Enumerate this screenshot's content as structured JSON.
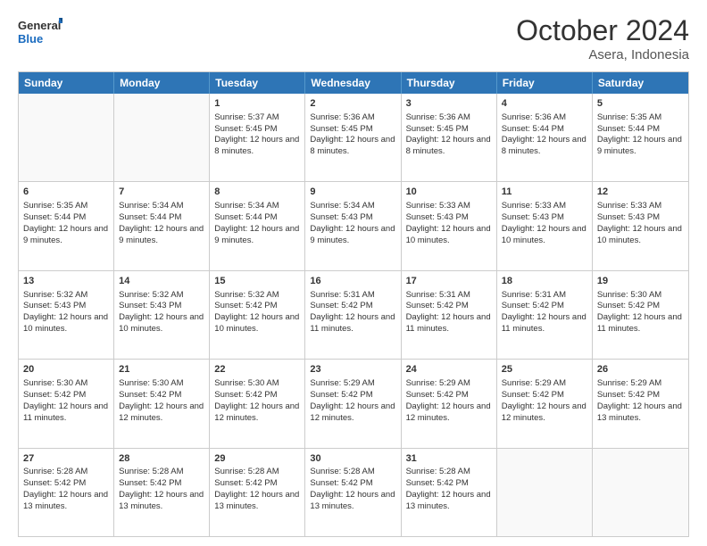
{
  "header": {
    "logo_line1": "General",
    "logo_line2": "Blue",
    "title": "October 2024",
    "subtitle": "Asera, Indonesia"
  },
  "weekdays": [
    "Sunday",
    "Monday",
    "Tuesday",
    "Wednesday",
    "Thursday",
    "Friday",
    "Saturday"
  ],
  "weeks": [
    [
      {
        "day": "",
        "info": ""
      },
      {
        "day": "",
        "info": ""
      },
      {
        "day": "1",
        "info": "Sunrise: 5:37 AM\nSunset: 5:45 PM\nDaylight: 12 hours and 8 minutes."
      },
      {
        "day": "2",
        "info": "Sunrise: 5:36 AM\nSunset: 5:45 PM\nDaylight: 12 hours and 8 minutes."
      },
      {
        "day": "3",
        "info": "Sunrise: 5:36 AM\nSunset: 5:45 PM\nDaylight: 12 hours and 8 minutes."
      },
      {
        "day": "4",
        "info": "Sunrise: 5:36 AM\nSunset: 5:44 PM\nDaylight: 12 hours and 8 minutes."
      },
      {
        "day": "5",
        "info": "Sunrise: 5:35 AM\nSunset: 5:44 PM\nDaylight: 12 hours and 9 minutes."
      }
    ],
    [
      {
        "day": "6",
        "info": "Sunrise: 5:35 AM\nSunset: 5:44 PM\nDaylight: 12 hours and 9 minutes."
      },
      {
        "day": "7",
        "info": "Sunrise: 5:34 AM\nSunset: 5:44 PM\nDaylight: 12 hours and 9 minutes."
      },
      {
        "day": "8",
        "info": "Sunrise: 5:34 AM\nSunset: 5:44 PM\nDaylight: 12 hours and 9 minutes."
      },
      {
        "day": "9",
        "info": "Sunrise: 5:34 AM\nSunset: 5:43 PM\nDaylight: 12 hours and 9 minutes."
      },
      {
        "day": "10",
        "info": "Sunrise: 5:33 AM\nSunset: 5:43 PM\nDaylight: 12 hours and 10 minutes."
      },
      {
        "day": "11",
        "info": "Sunrise: 5:33 AM\nSunset: 5:43 PM\nDaylight: 12 hours and 10 minutes."
      },
      {
        "day": "12",
        "info": "Sunrise: 5:33 AM\nSunset: 5:43 PM\nDaylight: 12 hours and 10 minutes."
      }
    ],
    [
      {
        "day": "13",
        "info": "Sunrise: 5:32 AM\nSunset: 5:43 PM\nDaylight: 12 hours and 10 minutes."
      },
      {
        "day": "14",
        "info": "Sunrise: 5:32 AM\nSunset: 5:43 PM\nDaylight: 12 hours and 10 minutes."
      },
      {
        "day": "15",
        "info": "Sunrise: 5:32 AM\nSunset: 5:42 PM\nDaylight: 12 hours and 10 minutes."
      },
      {
        "day": "16",
        "info": "Sunrise: 5:31 AM\nSunset: 5:42 PM\nDaylight: 12 hours and 11 minutes."
      },
      {
        "day": "17",
        "info": "Sunrise: 5:31 AM\nSunset: 5:42 PM\nDaylight: 12 hours and 11 minutes."
      },
      {
        "day": "18",
        "info": "Sunrise: 5:31 AM\nSunset: 5:42 PM\nDaylight: 12 hours and 11 minutes."
      },
      {
        "day": "19",
        "info": "Sunrise: 5:30 AM\nSunset: 5:42 PM\nDaylight: 12 hours and 11 minutes."
      }
    ],
    [
      {
        "day": "20",
        "info": "Sunrise: 5:30 AM\nSunset: 5:42 PM\nDaylight: 12 hours and 11 minutes."
      },
      {
        "day": "21",
        "info": "Sunrise: 5:30 AM\nSunset: 5:42 PM\nDaylight: 12 hours and 12 minutes."
      },
      {
        "day": "22",
        "info": "Sunrise: 5:30 AM\nSunset: 5:42 PM\nDaylight: 12 hours and 12 minutes."
      },
      {
        "day": "23",
        "info": "Sunrise: 5:29 AM\nSunset: 5:42 PM\nDaylight: 12 hours and 12 minutes."
      },
      {
        "day": "24",
        "info": "Sunrise: 5:29 AM\nSunset: 5:42 PM\nDaylight: 12 hours and 12 minutes."
      },
      {
        "day": "25",
        "info": "Sunrise: 5:29 AM\nSunset: 5:42 PM\nDaylight: 12 hours and 12 minutes."
      },
      {
        "day": "26",
        "info": "Sunrise: 5:29 AM\nSunset: 5:42 PM\nDaylight: 12 hours and 13 minutes."
      }
    ],
    [
      {
        "day": "27",
        "info": "Sunrise: 5:28 AM\nSunset: 5:42 PM\nDaylight: 12 hours and 13 minutes."
      },
      {
        "day": "28",
        "info": "Sunrise: 5:28 AM\nSunset: 5:42 PM\nDaylight: 12 hours and 13 minutes."
      },
      {
        "day": "29",
        "info": "Sunrise: 5:28 AM\nSunset: 5:42 PM\nDaylight: 12 hours and 13 minutes."
      },
      {
        "day": "30",
        "info": "Sunrise: 5:28 AM\nSunset: 5:42 PM\nDaylight: 12 hours and 13 minutes."
      },
      {
        "day": "31",
        "info": "Sunrise: 5:28 AM\nSunset: 5:42 PM\nDaylight: 12 hours and 13 minutes."
      },
      {
        "day": "",
        "info": ""
      },
      {
        "day": "",
        "info": ""
      }
    ]
  ]
}
